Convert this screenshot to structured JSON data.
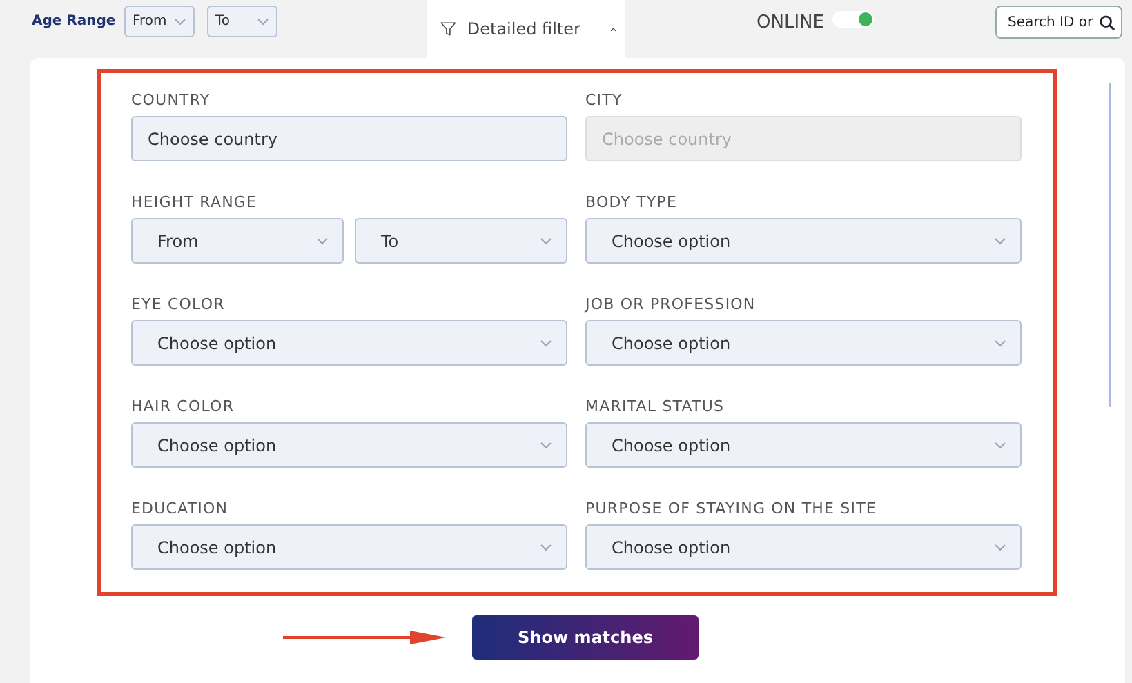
{
  "top_bar": {
    "age_range": {
      "label": "Age Range",
      "from": "From",
      "to": "To"
    },
    "filter_tab": {
      "label": "Detailed filter",
      "expanded": true
    },
    "online": {
      "label": "ONLINE",
      "on": true
    },
    "search": {
      "placeholder": "Search ID or"
    }
  },
  "filters": [
    {
      "label": "COUNTRY",
      "kind": "input",
      "placeholder": "Choose country"
    },
    {
      "label": "CITY",
      "kind": "disabled",
      "placeholder": "Choose country"
    },
    {
      "label": "HEIGHT RANGE",
      "kind": "range",
      "from": "From",
      "to": "To"
    },
    {
      "label": "BODY TYPE",
      "kind": "select",
      "value": "Choose option"
    },
    {
      "label": "EYE COLOR",
      "kind": "select",
      "value": "Choose option"
    },
    {
      "label": "JOB OR PROFESSION",
      "kind": "select",
      "value": "Choose option"
    },
    {
      "label": "HAIR COLOR",
      "kind": "select",
      "value": "Choose option"
    },
    {
      "label": "MARITAL STATUS",
      "kind": "select",
      "value": "Choose option"
    },
    {
      "label": "EDUCATION",
      "kind": "select",
      "value": "Choose option"
    },
    {
      "label": "PURPOSE OF STAYING ON THE SITE",
      "kind": "select",
      "value": "Choose option"
    }
  ],
  "submit": {
    "label": "Show matches"
  }
}
